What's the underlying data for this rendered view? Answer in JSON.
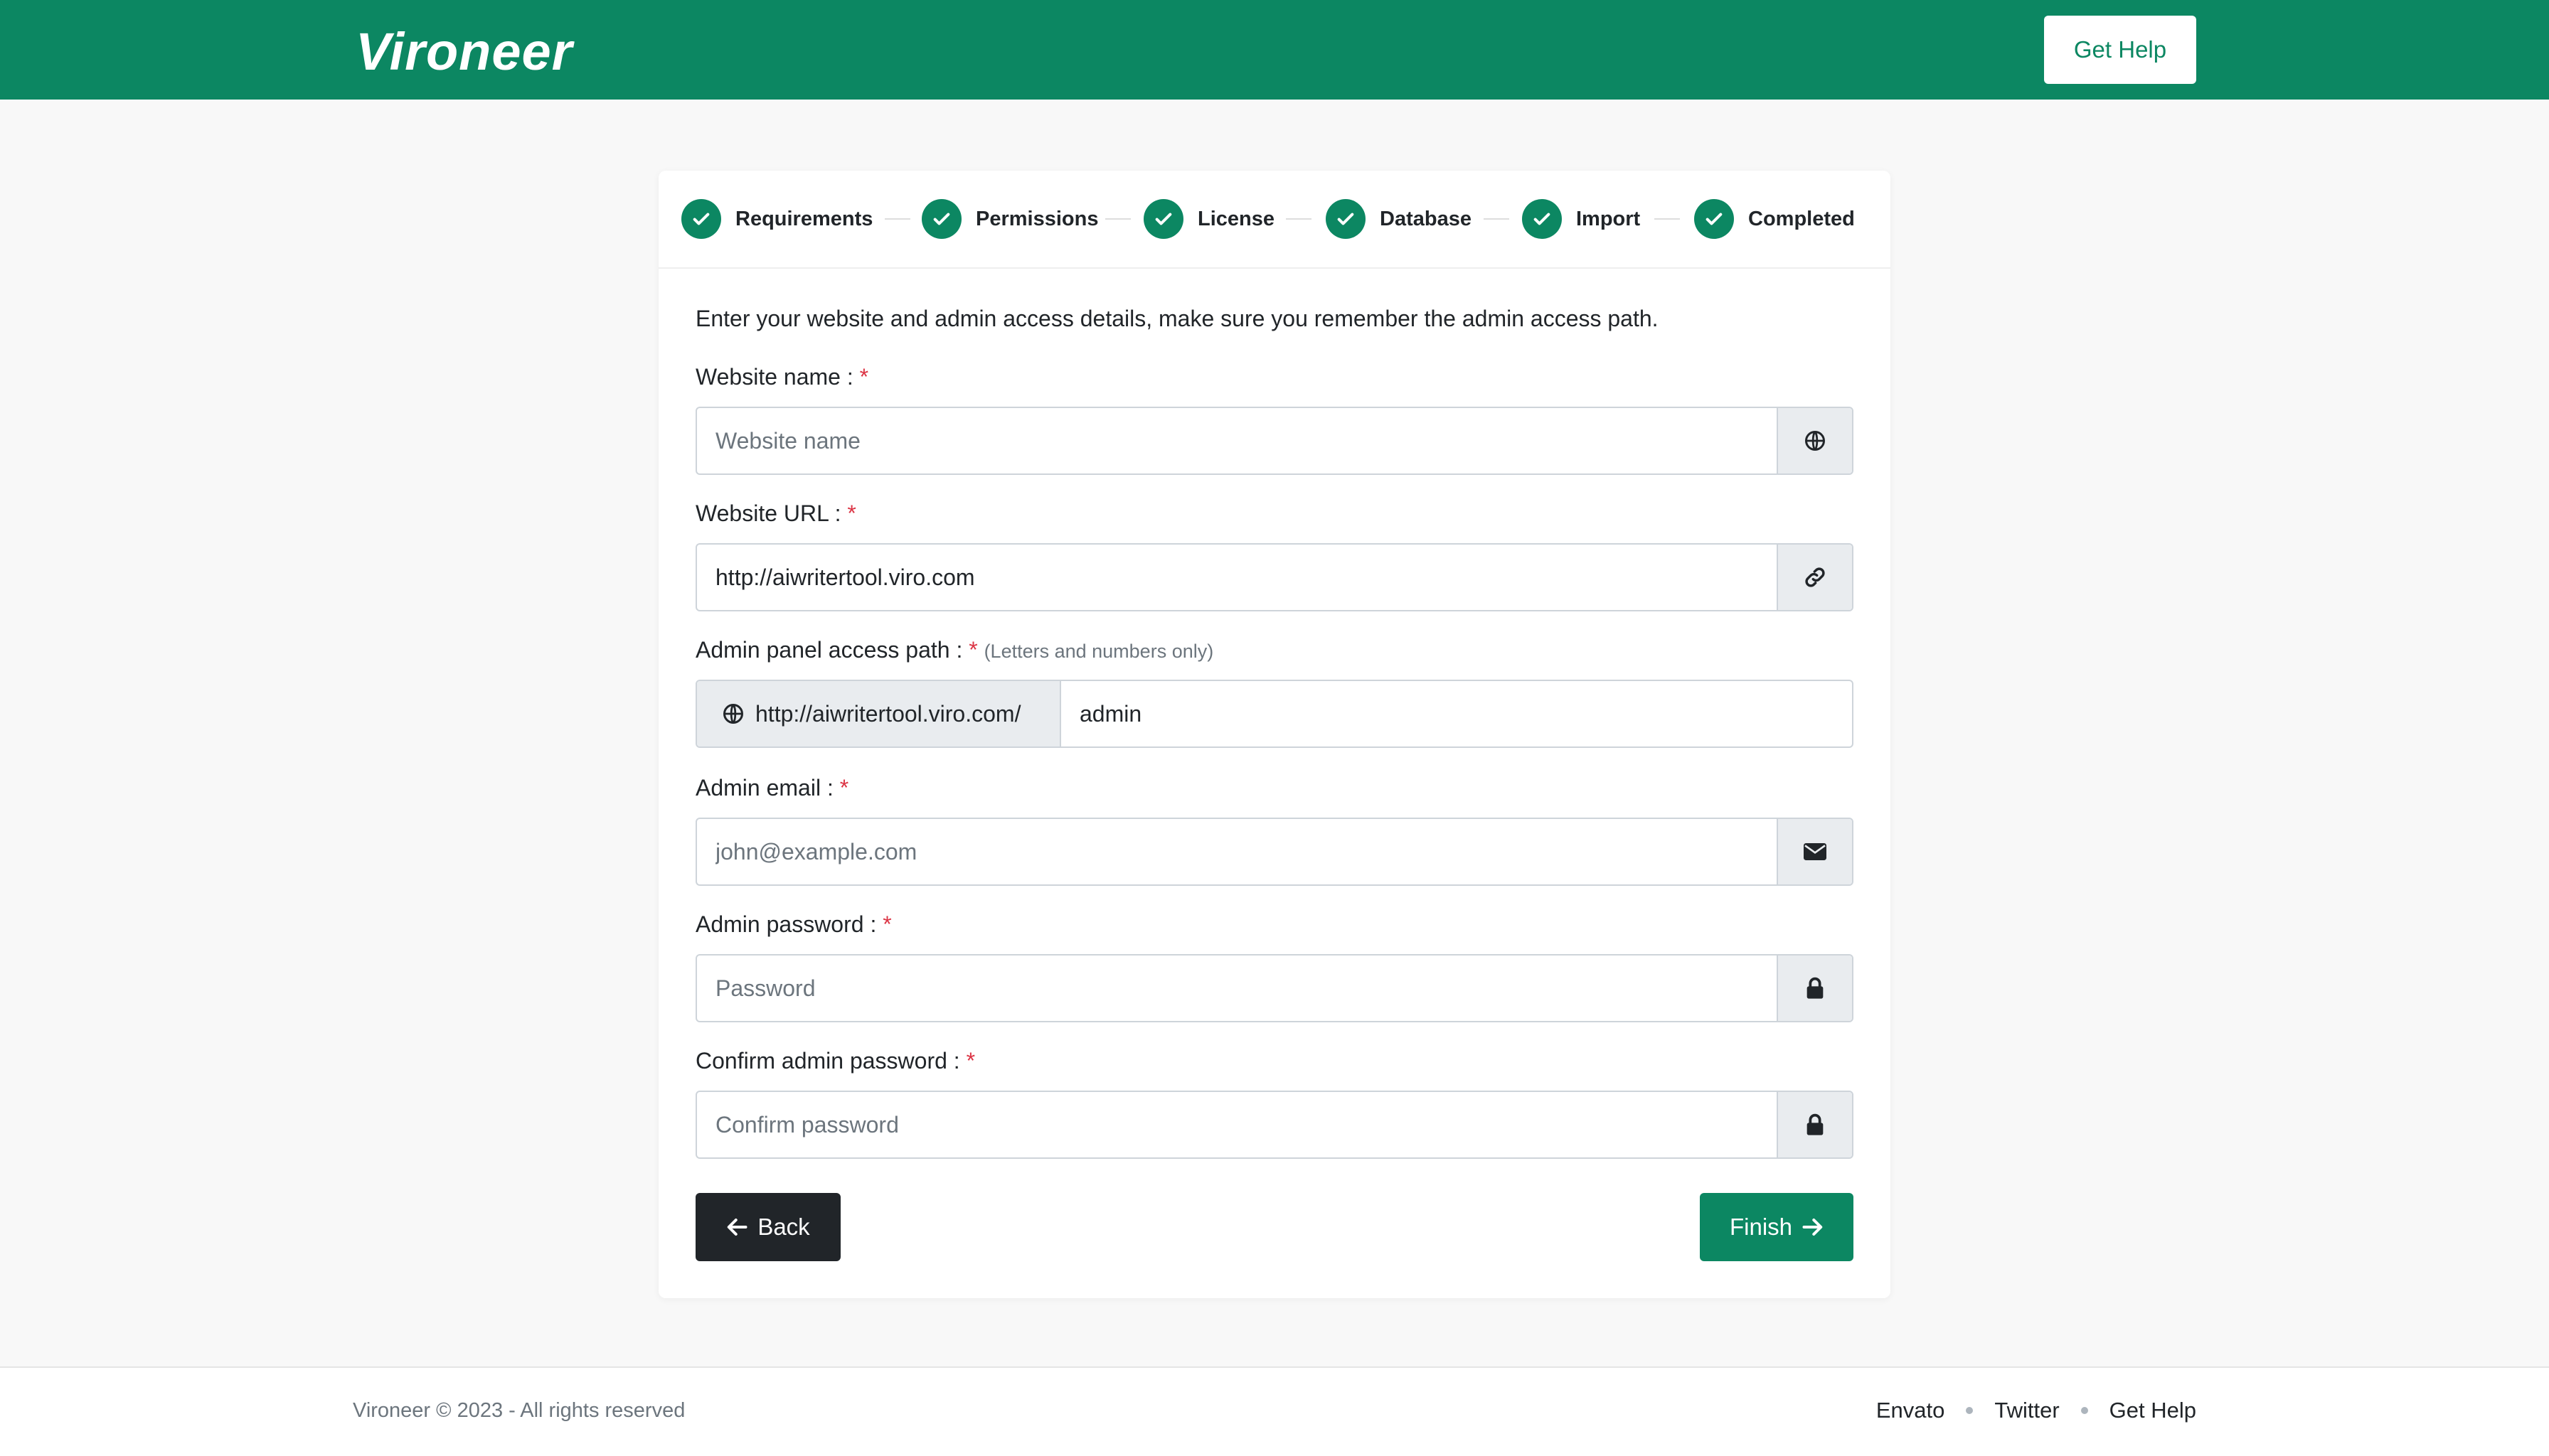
{
  "header": {
    "logo": "Vironeer",
    "help_label": "Get Help"
  },
  "colors": {
    "brand": "#0c8762",
    "dark_button": "#212529",
    "required": "#dc3545"
  },
  "steps": [
    {
      "label": "Requirements",
      "status": "complete"
    },
    {
      "label": "Permissions",
      "status": "complete"
    },
    {
      "label": "License",
      "status": "complete"
    },
    {
      "label": "Database",
      "status": "complete"
    },
    {
      "label": "Import",
      "status": "complete"
    },
    {
      "label": "Completed",
      "status": "complete"
    }
  ],
  "form": {
    "intro": "Enter your website and admin access details, make sure you remember the admin access path.",
    "required_mark": "*",
    "website_name": {
      "label": "Website name :",
      "placeholder": "Website name",
      "value": "",
      "icon": "globe-icon"
    },
    "website_url": {
      "label": "Website URL :",
      "value": "http://aiwritertool.viro.com",
      "icon": "link-icon"
    },
    "admin_path": {
      "label": "Admin panel access path :",
      "hint": "(Letters and numbers only)",
      "prefix": "http://aiwritertool.viro.com/",
      "value": "admin",
      "icon": "globe-icon"
    },
    "admin_email": {
      "label": "Admin email :",
      "placeholder": "john@example.com",
      "value": "",
      "icon": "envelope-icon"
    },
    "admin_password": {
      "label": "Admin password :",
      "placeholder": "Password",
      "value": "",
      "icon": "lock-icon"
    },
    "confirm_password": {
      "label": "Confirm admin password :",
      "placeholder": "Confirm password",
      "value": "",
      "icon": "lock-icon"
    },
    "back_label": "Back",
    "finish_label": "Finish"
  },
  "footer": {
    "copyright": "Vironeer © 2023 - All rights reserved",
    "links": [
      "Envato",
      "Twitter",
      "Get Help"
    ]
  }
}
